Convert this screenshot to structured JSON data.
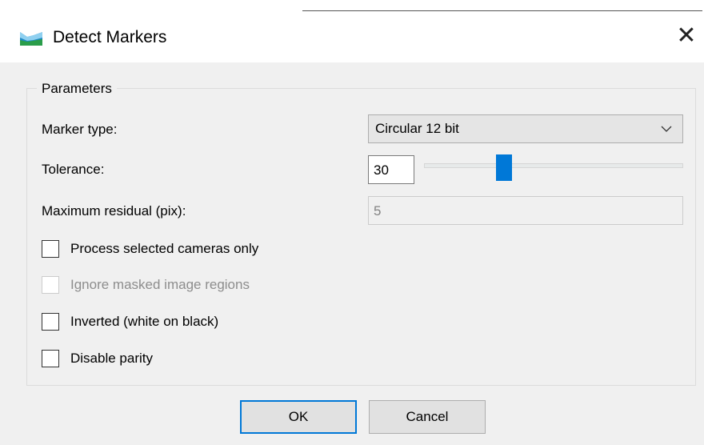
{
  "window": {
    "title": "Detect Markers",
    "icon": "app-icon",
    "close_icon": "close-icon",
    "close_glyph": "✕"
  },
  "parameters": {
    "group_title": "Parameters",
    "marker_type": {
      "label": "Marker type:",
      "value": "Circular 12 bit"
    },
    "tolerance": {
      "label": "Tolerance:",
      "value": "30"
    },
    "max_residual": {
      "label": "Maximum residual (pix):",
      "value": "5"
    },
    "checkboxes": [
      {
        "label": "Process selected cameras only",
        "checked": false,
        "enabled": true
      },
      {
        "label": "Ignore masked image regions",
        "checked": false,
        "enabled": false
      },
      {
        "label": "Inverted (white on black)",
        "checked": false,
        "enabled": true
      },
      {
        "label": "Disable parity",
        "checked": false,
        "enabled": true
      }
    ]
  },
  "buttons": {
    "ok": "OK",
    "cancel": "Cancel"
  },
  "colors": {
    "accent": "#0078d7",
    "background": "#f0f0f0",
    "titlebar": "#ffffff"
  }
}
